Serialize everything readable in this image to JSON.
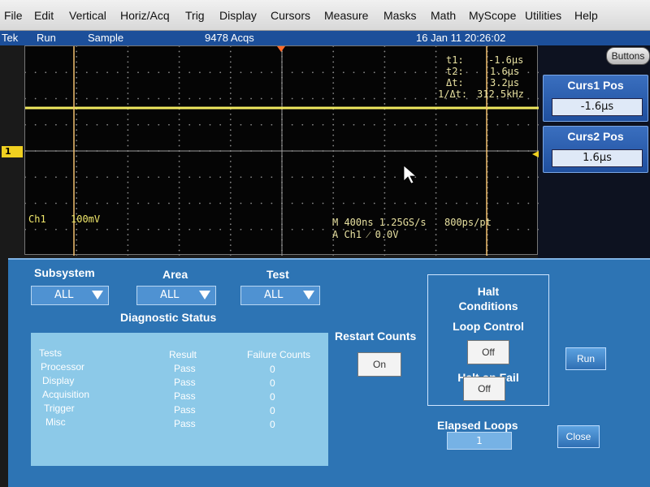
{
  "menu": [
    "File",
    "Edit",
    "Vertical",
    "Horiz/Acq",
    "Trig",
    "Display",
    "Cursors",
    "Measure",
    "Masks",
    "Math",
    "MyScope",
    "Utilities",
    "Help"
  ],
  "status": {
    "brand": "Tek",
    "mode": "Run",
    "acq_mode": "Sample",
    "acqs": "9478 Acqs",
    "datetime": "16 Jan 11 20:26:02"
  },
  "right_panel": {
    "buttons_label": "Buttons",
    "curs1": {
      "label": "Curs1 Pos",
      "value": "-1.6µs"
    },
    "curs2": {
      "label": "Curs2 Pos",
      "value": "1.6µs"
    }
  },
  "scope": {
    "ch_marker": "1",
    "cursor_readout": [
      {
        "label": "t1:",
        "value": "-1.6µs"
      },
      {
        "label": "t2:",
        "value": "1.6µs"
      },
      {
        "label": "Δt:",
        "value": "3.2µs"
      },
      {
        "label": "1/Δt:",
        "value": "312.5kHz"
      }
    ],
    "ch1_label": "Ch1",
    "ch1_scale": "100mV",
    "timebase": "M 400ns 1.25GS/s",
    "record": "800ps/pt",
    "trigger": "A  Ch1  ⁄  0.0V"
  },
  "diag": {
    "subsystem": {
      "label": "Subsystem",
      "value": "ALL"
    },
    "area": {
      "label": "Area",
      "value": "ALL"
    },
    "test": {
      "label": "Test",
      "value": "ALL"
    },
    "status_title": "Diagnostic Status",
    "table_headers": [
      "Tests",
      "Result",
      "Failure Counts"
    ],
    "rows": [
      {
        "test": "Processor",
        "result": "Pass",
        "failures": "0"
      },
      {
        "test": "Display",
        "result": "Pass",
        "failures": "0"
      },
      {
        "test": "Acquisition",
        "result": "Pass",
        "failures": "0"
      },
      {
        "test": "Trigger",
        "result": "Pass",
        "failures": "0"
      },
      {
        "test": "Misc",
        "result": "Pass",
        "failures": "0"
      }
    ],
    "restart_counts": {
      "label": "Restart Counts",
      "value": "On"
    },
    "halt_conditions_title_1": "Halt",
    "halt_conditions_title_2": "Conditions",
    "loop_control": {
      "label": "Loop Control",
      "value": "Off"
    },
    "halt_on_fail": {
      "label": "Halt on Fail",
      "value": "Off"
    },
    "run_label": "Run",
    "elapsed_loops": {
      "label": "Elapsed Loops",
      "value": "1"
    },
    "close_label": "Close"
  }
}
